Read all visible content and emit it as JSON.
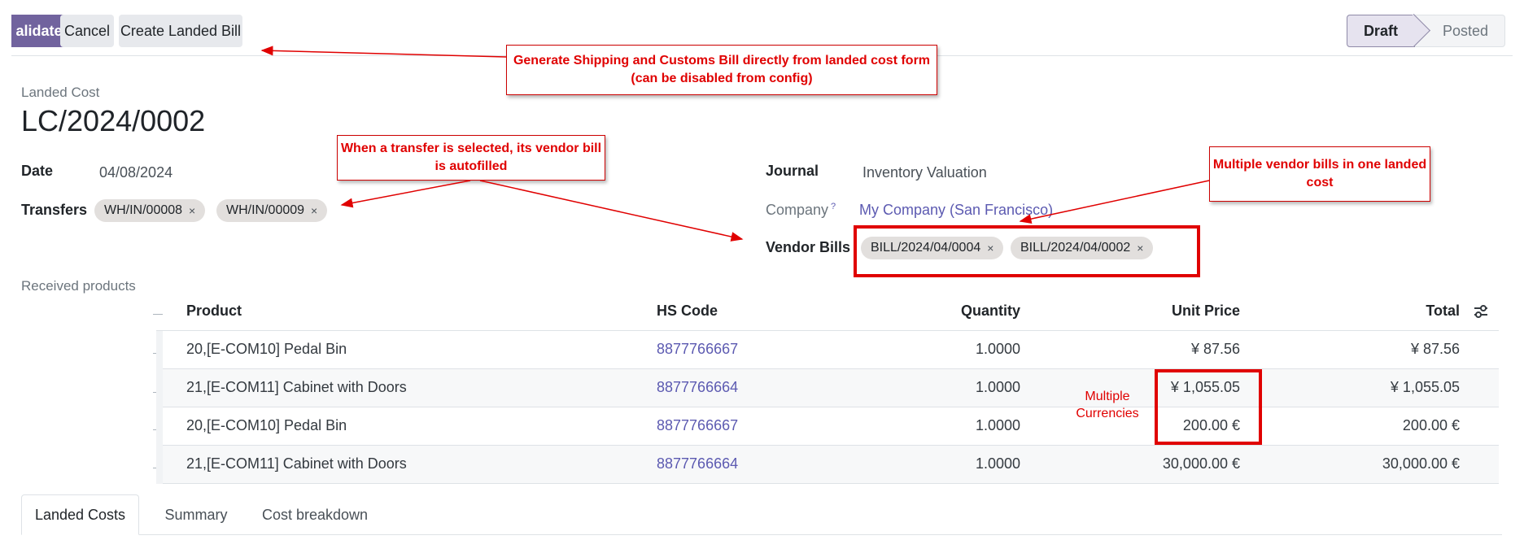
{
  "control_bar": {
    "validate_label": "Validate",
    "validate_visible": "alidate",
    "cancel_label": "Cancel",
    "create_bill_label": "Create Landed Bill"
  },
  "status_bar": {
    "stages": [
      "Draft",
      "Posted"
    ],
    "active": "Draft"
  },
  "form": {
    "record_type": "Landed Cost",
    "name": "LC/2024/0002",
    "date_label": "Date",
    "date_value": "04/08/2024",
    "transfers_label": "Transfers",
    "transfers": [
      "WH/IN/00008",
      "WH/IN/00009"
    ],
    "journal_label": "Journal",
    "journal_value": "Inventory Valuation",
    "company_label": "Company",
    "company_help": "?",
    "company_value": "My Company (San Francisco)",
    "vendor_bills_label": "Vendor Bills",
    "vendor_bills": [
      "BILL/2024/04/0004",
      "BILL/2024/04/0002"
    ],
    "tag_remove_icon": "×"
  },
  "received_products": {
    "label": "Received products",
    "columns": [
      "Product",
      "HS Code",
      "Quantity",
      "Unit Price",
      "Total"
    ],
    "rows": [
      {
        "product": "20,[E-COM10] Pedal Bin",
        "hs_code": "8877766667",
        "quantity": "1.0000",
        "unit_price": "¥ 87.56",
        "total": "¥ 87.56"
      },
      {
        "product": "21,[E-COM11] Cabinet with Doors",
        "hs_code": "8877766664",
        "quantity": "1.0000",
        "unit_price": "¥ 1,055.05",
        "total": "¥ 1,055.05"
      },
      {
        "product": "20,[E-COM10] Pedal Bin",
        "hs_code": "8877766667",
        "quantity": "1.0000",
        "unit_price": "200.00 €",
        "total": "200.00 €"
      },
      {
        "product": "21,[E-COM11] Cabinet with Doors",
        "hs_code": "8877766664",
        "quantity": "1.0000",
        "unit_price": "30,000.00 €",
        "total": "30,000.00 €"
      }
    ],
    "column_settings_icon": "sliders-icon"
  },
  "tabs": [
    "Landed Costs",
    "Summary",
    "Cost breakdown"
  ],
  "annotations": {
    "create_bill_note": "Generate Shipping and  Customs Bill directly from landed cost form (can be disabled from config)",
    "transfer_note": "When a transfer is selected, its vendor bill is autofilled",
    "vendor_bills_note": "Multiple vendor bills in one landed cost",
    "currencies_note": "Multiple Currencies"
  },
  "colors": {
    "primary": "#71639e",
    "link": "#5c5ab1",
    "annotation": "#e00000"
  }
}
